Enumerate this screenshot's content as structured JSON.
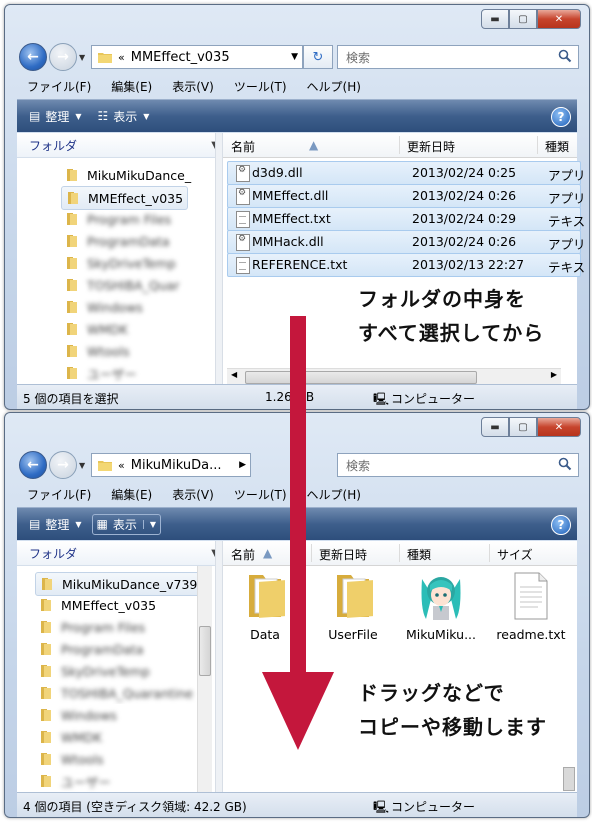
{
  "window_top": {
    "address_path": "MMEffect_v035",
    "search_placeholder": "検索",
    "menu": [
      "ファイル(F)",
      "編集(E)",
      "表示(V)",
      "ツール(T)",
      "ヘルプ(H)"
    ],
    "toolbar": {
      "organize": "整理",
      "view": "表示"
    },
    "sidebar_header": "フォルダ",
    "sidebar_items": [
      "MikuMikuDance_",
      "MMEffect_v035",
      "Program Files",
      "ProgramData",
      "SkyDriveTemp",
      "TOSHIBA_Quar",
      "Windows",
      "WMDK",
      "Wtools",
      "ユーザー"
    ],
    "columns": [
      "名前",
      "更新日時",
      "種類"
    ],
    "files": [
      {
        "name": "d3d9.dll",
        "date": "2013/02/24 0:25",
        "type": "アプリ",
        "icon": "dll"
      },
      {
        "name": "MMEffect.dll",
        "date": "2013/02/24 0:26",
        "type": "アプリ",
        "icon": "dll"
      },
      {
        "name": "MMEffect.txt",
        "date": "2013/02/24 0:29",
        "type": "テキス",
        "icon": "txt"
      },
      {
        "name": "MMHack.dll",
        "date": "2013/02/24 0:26",
        "type": "アプリ",
        "icon": "dll"
      },
      {
        "name": "REFERENCE.txt",
        "date": "2013/02/13 22:27",
        "type": "テキス",
        "icon": "txt"
      }
    ],
    "status_selected": "5 個の項目を選択",
    "status_size": "1.26 MB",
    "status_location": "コンピューター"
  },
  "window_bottom": {
    "address_path": "MikuMikuDa...",
    "search_placeholder": "検索",
    "menu": [
      "ファイル(F)",
      "編集(E)",
      "表示(V)",
      "ツール(T)",
      "ヘルプ(H)"
    ],
    "toolbar": {
      "organize": "整理",
      "view": "表示"
    },
    "sidebar_header": "フォルダ",
    "sidebar_items": [
      "MikuMikuDance_v739",
      "MMEffect_v035",
      "Program Files",
      "ProgramData",
      "SkyDriveTemp",
      "TOSHIBA_Quarantine",
      "Windows",
      "WMDK",
      "Wtools",
      "ユーザー"
    ],
    "columns": [
      "名前",
      "更新日時",
      "種類",
      "サイズ"
    ],
    "items": [
      {
        "label": "Data",
        "icon": "folder-icon"
      },
      {
        "label": "UserFile",
        "icon": "folder-icon"
      },
      {
        "label": "MikuMiku...",
        "icon": "miku-app-icon"
      },
      {
        "label": "readme.txt",
        "icon": "text-file-icon"
      }
    ],
    "status_count": "4 個の項目 (空きディスク領域: 42.2 GB)",
    "status_location": "コンピューター"
  },
  "annotations": {
    "top_line1": "フォルダの中身を",
    "top_line2": "すべて選択してから",
    "bottom_line1": "ドラッグなどで",
    "bottom_line2": "コピーや移動します"
  },
  "colors": {
    "arrow": "#c4173c",
    "selection": "#d4e6f7",
    "command_bar": "#3e5f8c"
  }
}
